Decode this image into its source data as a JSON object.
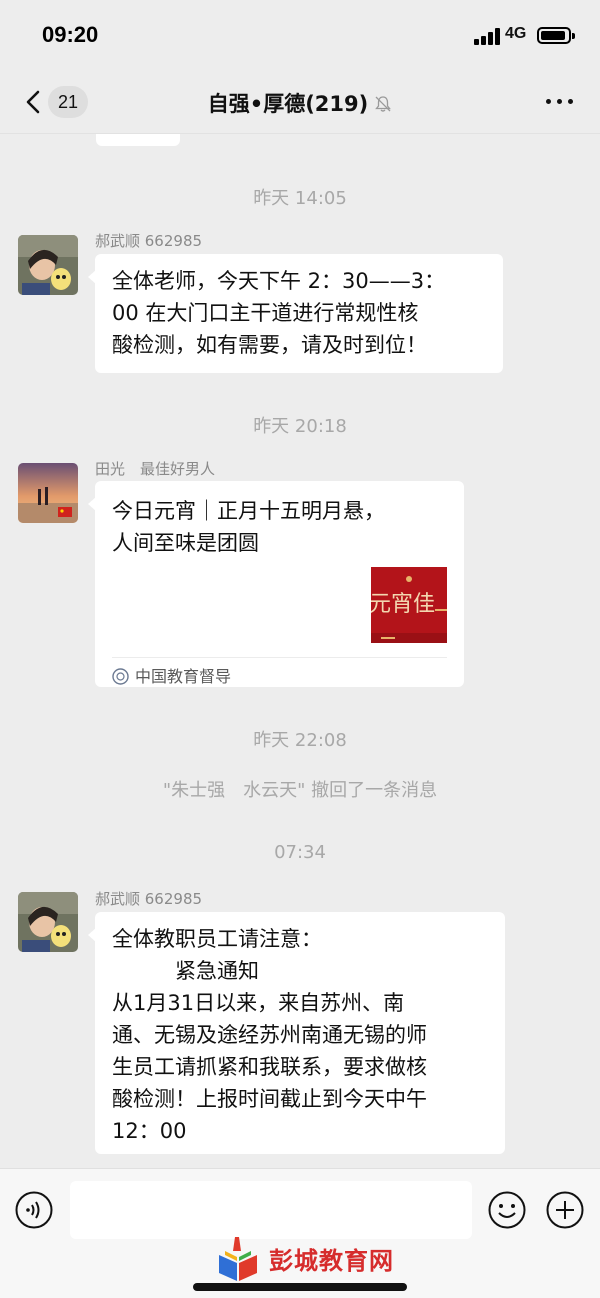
{
  "status_bar": {
    "time": "09:20",
    "network": "4G"
  },
  "nav": {
    "back_count": "21",
    "title": "自强•厚德(219)"
  },
  "messages": [
    {
      "timestamp": "昨天 14:05",
      "sender": "郝武顺 662985",
      "lines": [
        "全体老师，今天下午 2：30——3：",
        "00 在大门口主干道进行常规性核",
        "酸检测，如有需要，请及时到位！"
      ]
    },
    {
      "timestamp": "昨天 20:18",
      "sender": "田光　最佳好男人",
      "card": {
        "title_lines": [
          "今日元宵｜正月十五明月悬，",
          "人间至味是团圆"
        ],
        "thumb_text": "元宵佳",
        "source": "中国教育督导"
      }
    },
    {
      "timestamp": "昨天 22:08",
      "system": "\"朱士强　水云天\" 撤回了一条消息"
    },
    {
      "timestamp": "07:34",
      "sender": "郝武顺 662985",
      "lines": [
        "全体教职员工请注意：",
        "　　　紧急通知",
        "从1月31日以来，来自苏州、南",
        "通、无锡及途经苏州南通无锡的师",
        "生员工请抓紧和我联系，要求做核",
        "酸检测！上报时间截止到今天中午",
        "12：00"
      ]
    }
  ],
  "input": {
    "placeholder": ""
  },
  "watermark": {
    "text": "彭城教育网"
  },
  "colors": {
    "background": "#ededed",
    "bubble": "#ffffff",
    "timestamp": "#a8a8a8",
    "watermark": "#d62c2c"
  }
}
